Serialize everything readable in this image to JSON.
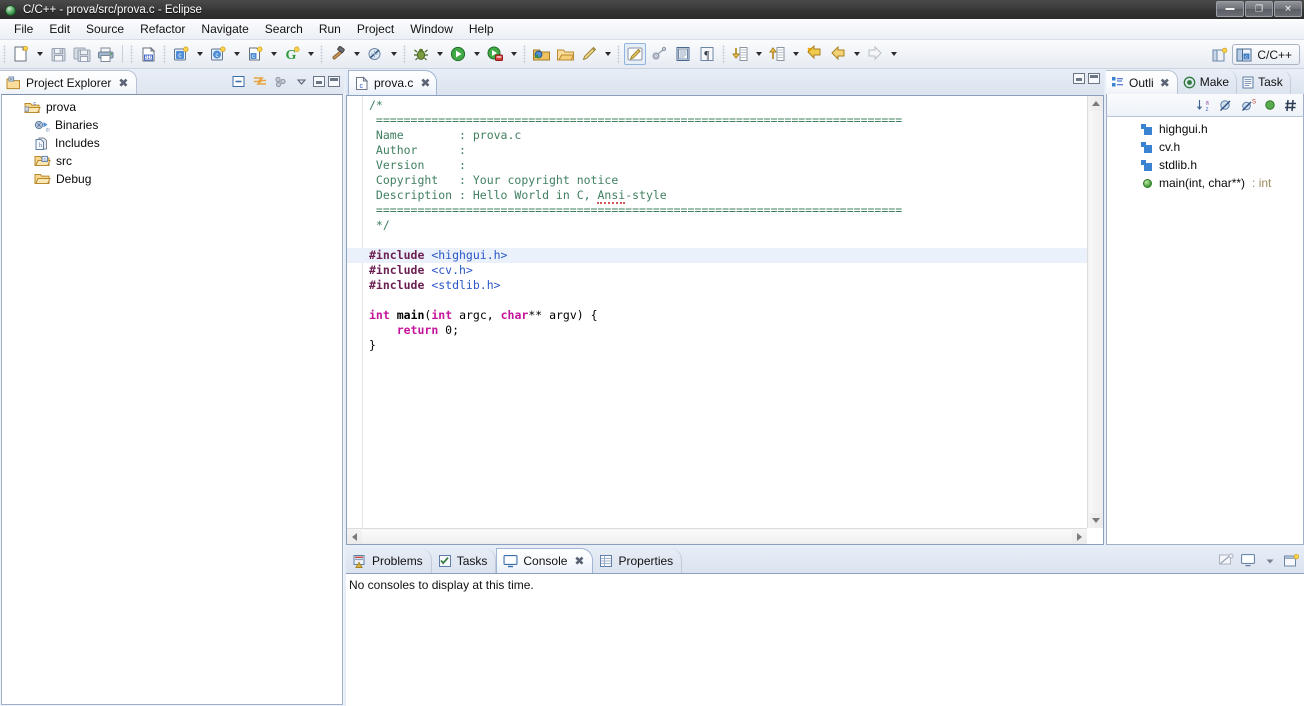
{
  "window": {
    "title": "C/C++ - prova/src/prova.c - Eclipse",
    "app_icon": "eclipse-globe-icon",
    "controls": [
      {
        "name": "minimize-button",
        "glyph": "–"
      },
      {
        "name": "maximize-button",
        "glyph": "❐"
      },
      {
        "name": "close-button",
        "glyph": "✕"
      }
    ]
  },
  "menubar": {
    "items": [
      {
        "label": "File"
      },
      {
        "label": "Edit"
      },
      {
        "label": "Source"
      },
      {
        "label": "Refactor"
      },
      {
        "label": "Navigate"
      },
      {
        "label": "Search"
      },
      {
        "label": "Run"
      },
      {
        "label": "Project"
      },
      {
        "label": "Window"
      },
      {
        "label": "Help"
      }
    ]
  },
  "toolbar": {
    "groups": [
      {
        "buttons": [
          {
            "name": "new-button",
            "icon": "new-file-icon",
            "dropdown": true
          },
          {
            "name": "save-button",
            "icon": "save-icon",
            "dropdown": false
          },
          {
            "name": "save-all-button",
            "icon": "save-all-icon",
            "dropdown": false
          },
          {
            "name": "print-button",
            "icon": "print-icon",
            "dropdown": false
          }
        ]
      },
      {
        "buttons": [
          {
            "name": "build-all-button",
            "icon": "binary-file-icon",
            "dropdown": false
          }
        ]
      },
      {
        "buttons": [
          {
            "name": "new-c-project-button",
            "icon": "new-c-project-icon",
            "dropdown": true
          },
          {
            "name": "new-class-button",
            "icon": "new-class-icon",
            "dropdown": true
          },
          {
            "name": "new-c-source-button",
            "icon": "new-c-source-icon",
            "dropdown": true
          },
          {
            "name": "new-gnu-button",
            "icon": "gnu-icon",
            "dropdown": true
          }
        ]
      },
      {
        "buttons": [
          {
            "name": "build-button",
            "icon": "hammer-icon",
            "dropdown": true
          },
          {
            "name": "clean-button",
            "icon": "clean-icon",
            "dropdown": true
          }
        ]
      },
      {
        "buttons": [
          {
            "name": "debug-button",
            "icon": "bug-icon",
            "dropdown": true
          },
          {
            "name": "run-button",
            "icon": "run-icon",
            "dropdown": true
          },
          {
            "name": "external-tools-button",
            "icon": "external-tools-icon",
            "dropdown": true
          }
        ]
      },
      {
        "buttons": [
          {
            "name": "open-type-button",
            "icon": "open-type-icon",
            "dropdown": false
          },
          {
            "name": "open-resource-button",
            "icon": "open-folder-icon",
            "dropdown": false
          },
          {
            "name": "search-marker-button",
            "icon": "pencil-marker-icon",
            "dropdown": true
          }
        ]
      },
      {
        "buttons": [
          {
            "name": "toggle-marker-button",
            "icon": "highlight-pen-icon",
            "dropdown": false
          },
          {
            "name": "toggle-breakpoint-button",
            "icon": "breakpoint-icon",
            "dropdown": false
          },
          {
            "name": "show-source-button",
            "icon": "book-icon",
            "dropdown": false
          },
          {
            "name": "show-whitespace-button",
            "icon": "pilcrow-icon",
            "dropdown": false
          }
        ]
      },
      {
        "buttons": [
          {
            "name": "next-annotation-button",
            "icon": "next-annotation-icon",
            "dropdown": true
          },
          {
            "name": "previous-annotation-button",
            "icon": "previous-annotation-icon",
            "dropdown": true
          },
          {
            "name": "last-edit-location-button",
            "icon": "last-edit-icon",
            "dropdown": false
          },
          {
            "name": "back-button",
            "icon": "back-arrow-icon",
            "dropdown": true
          },
          {
            "name": "forward-button",
            "icon": "forward-arrow-icon",
            "dropdown": true
          }
        ]
      }
    ],
    "perspective": {
      "open_perspective_icon": "open-perspective-icon",
      "current_label": "C/C++",
      "current_icon": "c-cpp-perspective-icon"
    }
  },
  "project_explorer": {
    "tab_label": "Project Explorer",
    "tab_icon": "project-explorer-icon",
    "close_icon": "close-icon",
    "tools": [
      {
        "name": "collapse-all-button",
        "icon": "collapse-all-icon"
      },
      {
        "name": "link-with-editor-button",
        "icon": "link-editor-icon"
      },
      {
        "name": "view-menu-button",
        "icon": "view-menu-icon"
      },
      {
        "name": "minimize-view-button",
        "icon": "minimize-icon"
      },
      {
        "name": "maximize-view-button",
        "icon": "maximize-icon"
      }
    ],
    "tree": [
      {
        "label": "prova",
        "icon": "c-project-icon",
        "level": 1
      },
      {
        "label": "Binaries",
        "icon": "binaries-icon",
        "level": 2
      },
      {
        "label": "Includes",
        "icon": "includes-icon",
        "level": 2
      },
      {
        "label": "src",
        "icon": "source-folder-icon",
        "level": 2
      },
      {
        "label": "Debug",
        "icon": "folder-icon",
        "level": 2
      }
    ]
  },
  "editor": {
    "tab_label": "prova.c",
    "tab_icon": "c-source-file-icon",
    "close_icon": "close-icon",
    "tools": [
      {
        "name": "minimize-editor-button",
        "icon": "minimize-icon"
      },
      {
        "name": "maximize-editor-button",
        "icon": "maximize-icon"
      }
    ],
    "code_lines": [
      {
        "id": 1,
        "highlight": false,
        "spans": [
          {
            "t": "/*",
            "c": "comment"
          }
        ]
      },
      {
        "id": 2,
        "highlight": false,
        "spans": [
          {
            "t": " ============================================================================",
            "c": "comment"
          }
        ]
      },
      {
        "id": 3,
        "highlight": false,
        "spans": [
          {
            "t": " Name        : prova.c",
            "c": "comment"
          }
        ]
      },
      {
        "id": 4,
        "highlight": false,
        "spans": [
          {
            "t": " Author      : ",
            "c": "comment"
          }
        ]
      },
      {
        "id": 5,
        "highlight": false,
        "spans": [
          {
            "t": " Version     : ",
            "c": "comment"
          }
        ]
      },
      {
        "id": 6,
        "highlight": false,
        "spans": [
          {
            "t": " Copyright   : Your copyright notice",
            "c": "comment"
          }
        ]
      },
      {
        "id": 7,
        "highlight": false,
        "spans": [
          {
            "t": " Description : Hello World in C, ",
            "c": "comment"
          },
          {
            "t": "Ansi",
            "c": "comment-spell"
          },
          {
            "t": "-style",
            "c": "comment"
          }
        ]
      },
      {
        "id": 8,
        "highlight": false,
        "spans": [
          {
            "t": " ============================================================================",
            "c": "comment"
          }
        ]
      },
      {
        "id": 9,
        "highlight": false,
        "spans": [
          {
            "t": " */",
            "c": "comment"
          }
        ]
      },
      {
        "id": 10,
        "highlight": false,
        "spans": [
          {
            "t": "",
            "c": "plain"
          }
        ]
      },
      {
        "id": 11,
        "highlight": true,
        "spans": [
          {
            "t": "#include ",
            "c": "preproc"
          },
          {
            "t": "<highgui.h>",
            "c": "header"
          }
        ]
      },
      {
        "id": 12,
        "highlight": false,
        "spans": [
          {
            "t": "#include ",
            "c": "preproc"
          },
          {
            "t": "<cv.h>",
            "c": "header"
          }
        ]
      },
      {
        "id": 13,
        "highlight": false,
        "spans": [
          {
            "t": "#include ",
            "c": "preproc"
          },
          {
            "t": "<stdlib.h>",
            "c": "header"
          }
        ]
      },
      {
        "id": 14,
        "highlight": false,
        "spans": [
          {
            "t": "",
            "c": "plain"
          }
        ]
      },
      {
        "id": 15,
        "highlight": false,
        "spans": [
          {
            "t": "int",
            "c": "keyword"
          },
          {
            "t": " ",
            "c": "plain"
          },
          {
            "t": "main",
            "c": "plain-bold"
          },
          {
            "t": "(",
            "c": "plain"
          },
          {
            "t": "int",
            "c": "keyword"
          },
          {
            "t": " argc, ",
            "c": "plain"
          },
          {
            "t": "char",
            "c": "keyword"
          },
          {
            "t": "** argv) {",
            "c": "plain"
          }
        ]
      },
      {
        "id": 16,
        "highlight": false,
        "spans": [
          {
            "t": "    ",
            "c": "plain"
          },
          {
            "t": "return",
            "c": "keyword"
          },
          {
            "t": " 0;",
            "c": "plain"
          }
        ]
      },
      {
        "id": 17,
        "highlight": false,
        "spans": [
          {
            "t": "}",
            "c": "plain"
          }
        ]
      }
    ]
  },
  "outline": {
    "tabs": [
      {
        "label": "Outli",
        "icon": "outline-icon",
        "active": true,
        "has_close": true
      },
      {
        "label": "Make",
        "icon": "make-target-icon",
        "active": false,
        "has_close": false
      },
      {
        "label": "Task",
        "icon": "task-list-icon",
        "active": false,
        "has_close": false
      }
    ],
    "close_icon": "close-icon",
    "tools": [
      {
        "name": "sort-button",
        "icon": "sort-az-icon"
      },
      {
        "name": "hide-non-public-button",
        "icon": "hide-nonpublic-icon"
      },
      {
        "name": "hide-static-button",
        "icon": "hide-static-icon"
      },
      {
        "name": "hide-fields-button",
        "icon": "hide-fields-icon"
      },
      {
        "name": "hide-macros-button",
        "icon": "hide-macros-icon"
      }
    ],
    "items": [
      {
        "label": "highgui.h",
        "icon": "include-icon",
        "type": ""
      },
      {
        "label": "cv.h",
        "icon": "include-icon",
        "type": ""
      },
      {
        "label": "stdlib.h",
        "icon": "include-icon",
        "type": ""
      },
      {
        "label": "main(int, char**)",
        "icon": "function-icon",
        "type": " : int"
      }
    ]
  },
  "bottom": {
    "tabs": [
      {
        "label": "Problems",
        "icon": "problems-icon",
        "active": false,
        "has_close": false
      },
      {
        "label": "Tasks",
        "icon": "tasks-icon",
        "active": false,
        "has_close": false
      },
      {
        "label": "Console",
        "icon": "console-icon",
        "active": true,
        "has_close": true
      },
      {
        "label": "Properties",
        "icon": "properties-icon",
        "active": false,
        "has_close": false
      }
    ],
    "close_icon": "close-icon",
    "tools": [
      {
        "name": "clear-console-button",
        "icon": "clear-console-icon"
      },
      {
        "name": "display-selected-console-button",
        "icon": "display-console-icon"
      },
      {
        "name": "console-menu-button",
        "icon": "chevron-down-icon"
      },
      {
        "name": "open-console-button",
        "icon": "open-console-icon"
      }
    ],
    "console_message": "No consoles to display at this time."
  },
  "colors": {
    "comment": "#3f7f5f",
    "keyword": "#c5139a",
    "preprocessor": "#6c1f52",
    "header_string": "#2a56c6",
    "highlight_line": "#eaf1fb",
    "chrome": "#e8eef7",
    "titlebar": "#333333"
  }
}
